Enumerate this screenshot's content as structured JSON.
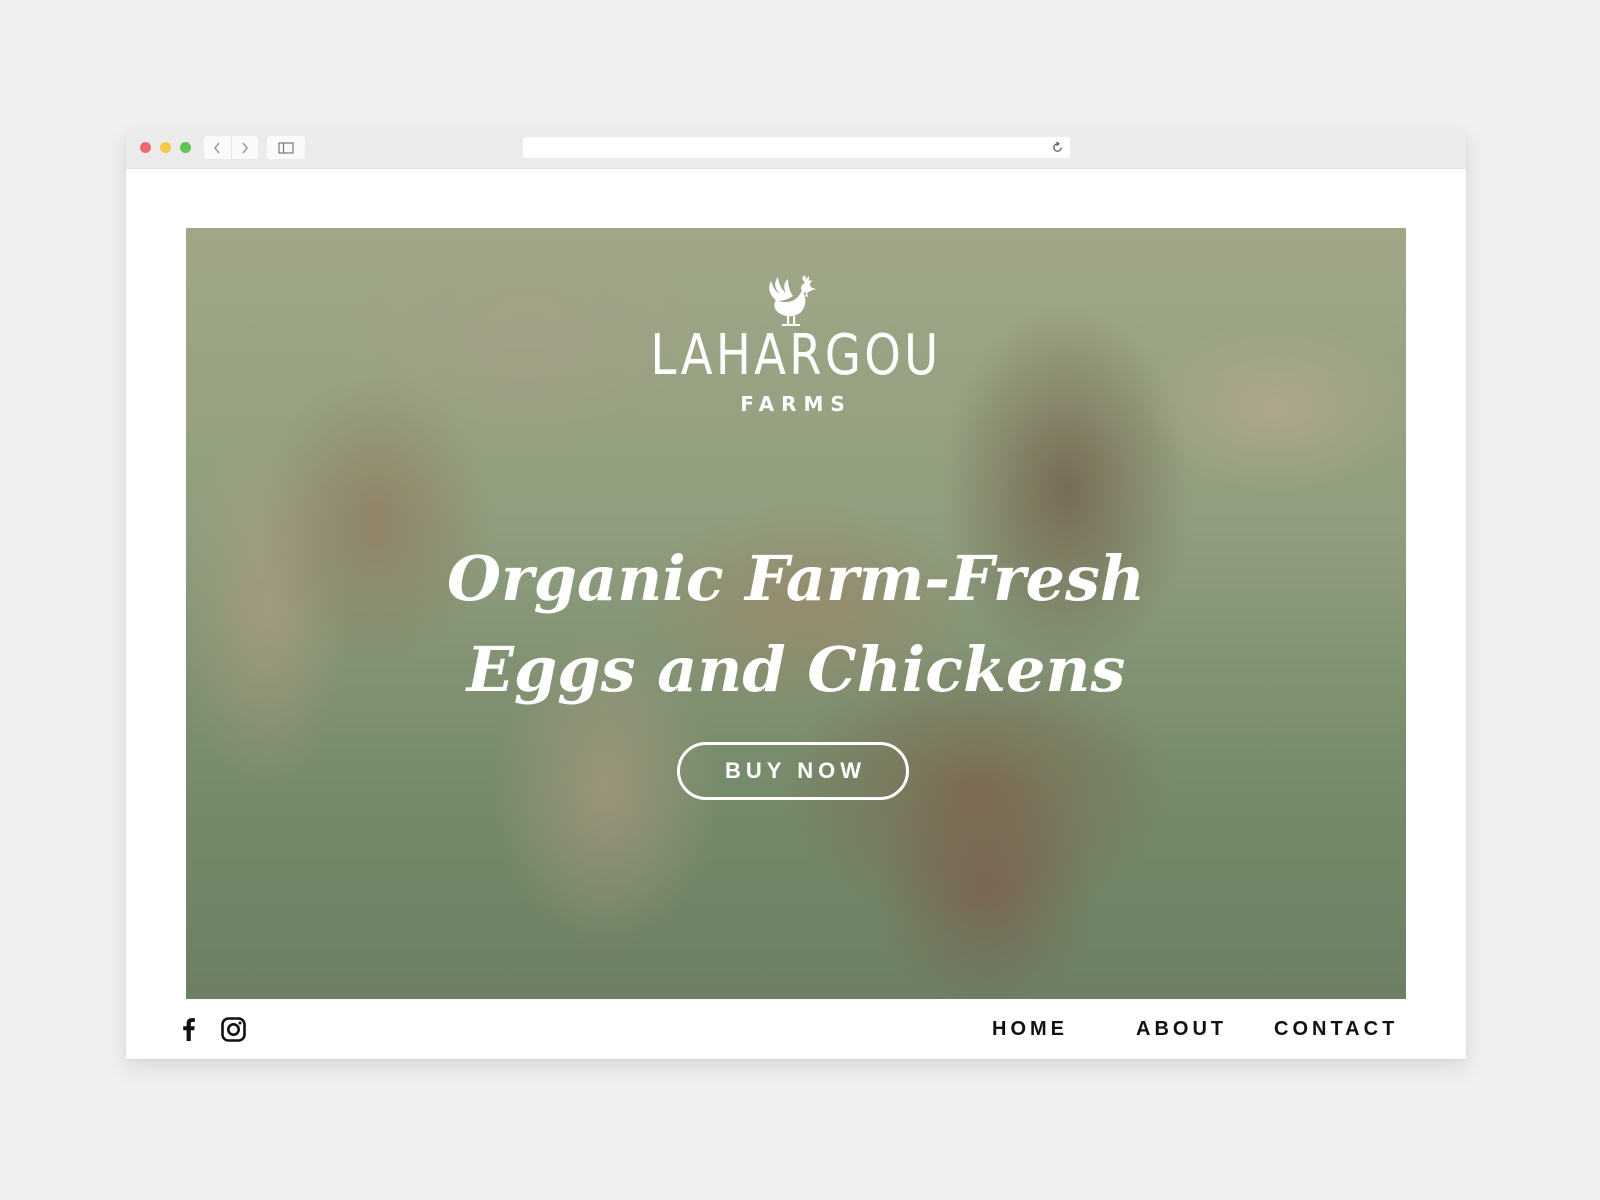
{
  "browser": {
    "url": "",
    "icons": {
      "back": "chevron-left-icon",
      "forward": "chevron-right-icon",
      "sidebar": "sidebar-toggle-icon",
      "reload": "reload-icon"
    }
  },
  "hero": {
    "logo_icon": "rooster-icon",
    "brand_name": "LAHARGOU",
    "brand_sub": "FARMS",
    "headline_line1": "Organic Farm-Fresh",
    "headline_line2": "Eggs and Chickens",
    "cta_label": "BUY NOW"
  },
  "footer": {
    "social": [
      "facebook-icon",
      "instagram-icon"
    ],
    "nav": {
      "home": "HOME",
      "about": "ABOUT",
      "contact": "CONTACT"
    }
  },
  "colors": {
    "page_background": "#f0f0f1",
    "nav_text": "#111111",
    "hero_text": "#ffffff",
    "window_close": "#ec6a6f",
    "window_minimize": "#f2c94c",
    "window_zoom": "#5fc454"
  }
}
